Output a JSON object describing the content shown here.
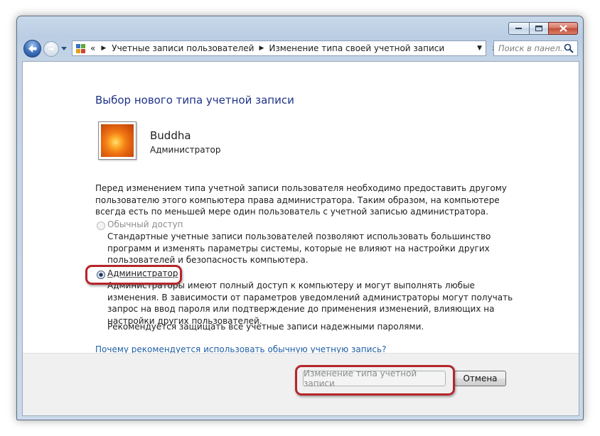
{
  "window": {
    "nav": {
      "back_icon": "back-arrow-icon",
      "forward_icon": "forward-arrow-icon",
      "history_icon": "dropdown-arrow-icon"
    },
    "address": {
      "icon": "control-panel-icon",
      "overflow": "«",
      "crumbs": [
        "Учетные записи пользователей",
        "Изменение типа своей учетной записи"
      ]
    },
    "search": {
      "placeholder": "Поиск в панел..."
    },
    "controls": [
      "minimize-icon",
      "maximize-icon",
      "close-icon"
    ]
  },
  "page": {
    "title": "Выбор нового типа учетной записи",
    "user": {
      "name": "Buddha",
      "role": "Администратор"
    },
    "intro": "Перед изменением типа учетной записи пользователя необходимо предоставить другому пользователю этого компьютера права администратора. Таким образом, на компьютере всегда есть по меньшей мере один пользователь с учетной записью администратора.",
    "options": [
      {
        "label": "Обычный доступ",
        "selected": false,
        "enabled": false,
        "description": "Стандартные учетные записи пользователей позволяют использовать большинство программ и изменять параметры системы, которые не влияют на настройки других пользователей и безопасность компьютера."
      },
      {
        "label": "Администратор",
        "selected": true,
        "enabled": true,
        "description": "Администраторы имеют полный доступ к компьютеру и могут выполнять любые изменения. В зависимости от параметров уведомлений администраторы могут получать запрос на ввод пароля или подтверждение до применения изменений, влияющих на настройки других пользователей."
      }
    ],
    "recommendation": "Рекомендуется защищать все учетные записи надежными паролями.",
    "help_link": "Почему рекомендуется использовать обычную учетную запись?"
  },
  "footer": {
    "change_button": "Изменение типа учетной записи",
    "change_enabled": false,
    "cancel_button": "Отмена"
  },
  "colors": {
    "highlight": "#b5262b",
    "title": "#1e3287",
    "link": "#1f5fa6",
    "close": "#c24c36"
  }
}
